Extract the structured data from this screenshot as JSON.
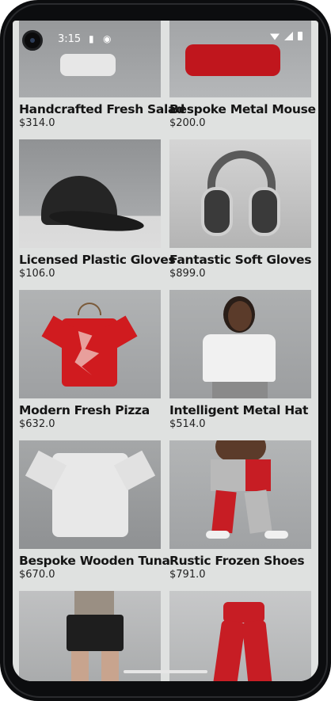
{
  "status": {
    "time": "3:15"
  },
  "products": [
    {
      "name": "Handcrafted Fresh Salad",
      "price": "$314.0",
      "image": "shirt-on-hanger"
    },
    {
      "name": "Bespoke Metal Mouse",
      "price": "$200.0",
      "image": "red-sweatshirt"
    },
    {
      "name": "Licensed Plastic Gloves",
      "price": "$106.0",
      "image": "black-cap"
    },
    {
      "name": "Fantastic Soft Gloves",
      "price": "$899.0",
      "image": "headphones"
    },
    {
      "name": "Modern Fresh Pizza",
      "price": "$632.0",
      "image": "red-tshirt-on-hanger"
    },
    {
      "name": "Intelligent Metal Hat",
      "price": "$514.0",
      "image": "model-white-tee"
    },
    {
      "name": "Bespoke Wooden Tuna",
      "price": "$670.0",
      "image": "white-tshirt"
    },
    {
      "name": "Rustic Frozen Shoes",
      "price": "$791.0",
      "image": "red-grey-joggers-model"
    },
    {
      "name": "",
      "price": "",
      "image": "black-shorts-model"
    },
    {
      "name": "",
      "price": "",
      "image": "red-joggers"
    }
  ],
  "colors": {
    "background": "#dfe1e0",
    "accent_red": "#d01b1f",
    "text": "#151515"
  }
}
